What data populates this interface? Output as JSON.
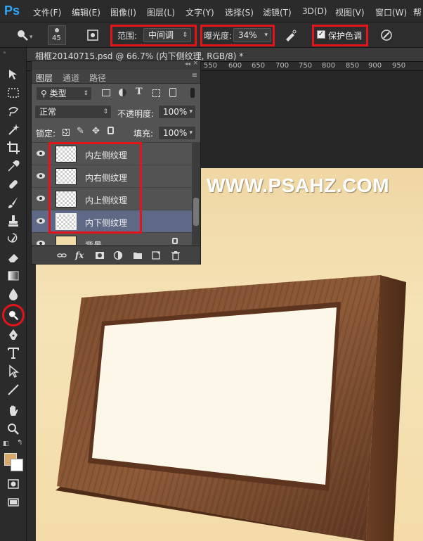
{
  "app": {
    "logo": "Ps"
  },
  "menu": [
    "文件(F)",
    "编辑(E)",
    "图像(I)",
    "图层(L)",
    "文字(Y)",
    "选择(S)",
    "滤镜(T)",
    "3D(D)",
    "视图(V)",
    "窗口(W)",
    "帮"
  ],
  "options_bar": {
    "brush_size": "45",
    "range_label": "范围:",
    "range_value": "中间调",
    "exposure_label": "曝光度:",
    "exposure_value": "34%",
    "protect_tone_label": "保护色调",
    "protect_tone_checked": true
  },
  "document": {
    "tab_title": "相框20140715.psd @ 66.7% (内下侧纹理, RGB/8) *",
    "ruler_ticks": [
      "550",
      "600",
      "650",
      "700",
      "750",
      "800",
      "850",
      "900",
      "950"
    ]
  },
  "watermark": "WWW.PSAHZ.COM",
  "layers_panel": {
    "tabs": [
      "图层",
      "通道",
      "路径"
    ],
    "filter_kind": "类型",
    "blend_mode": "正常",
    "opacity_label": "不透明度:",
    "opacity_value": "100%",
    "lock_label": "锁定:",
    "fill_label": "填充:",
    "fill_value": "100%",
    "layers": [
      {
        "name": "内左侧纹理",
        "visible": true,
        "selected": false
      },
      {
        "name": "内右侧纹理",
        "visible": true,
        "selected": false
      },
      {
        "name": "内上侧纹理",
        "visible": true,
        "selected": false
      },
      {
        "name": "内下侧纹理",
        "visible": true,
        "selected": true
      },
      {
        "name": "背景",
        "visible": true,
        "selected": false
      }
    ]
  },
  "colors": {
    "foreground": "#d8a96a",
    "background": "#ffffff",
    "highlight": "#e4141b",
    "selected_layer": "#5e6a85"
  }
}
